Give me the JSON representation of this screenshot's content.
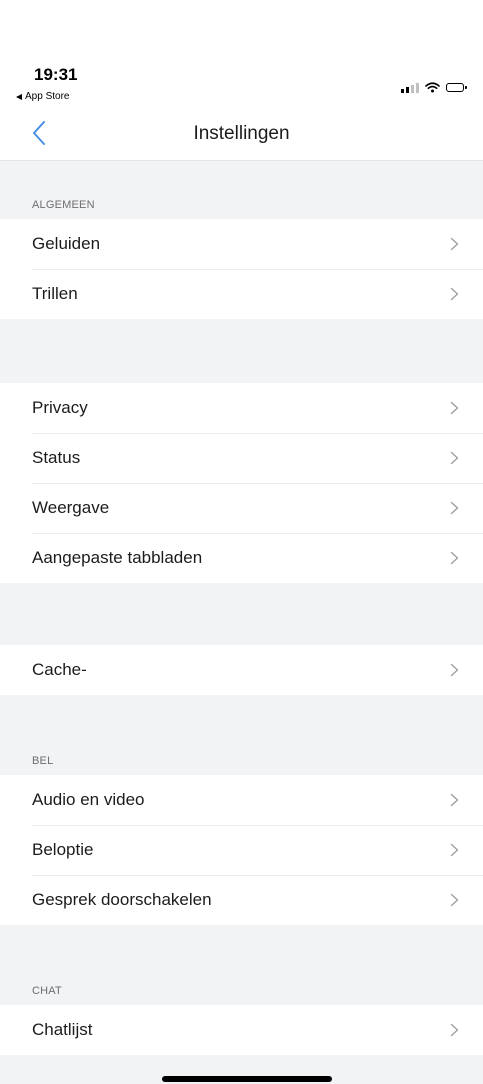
{
  "status_bar": {
    "time": "19:31",
    "back_app": "App Store",
    "icons": [
      "cellular-signal-icon",
      "wifi-icon",
      "battery-icon"
    ]
  },
  "nav": {
    "title": "Instellingen",
    "back_icon": "chevron-left-icon"
  },
  "colors": {
    "accent": "#4a90e2",
    "background": "#f2f3f5",
    "row_background": "#ffffff",
    "section_label": "#6d6d72",
    "chevron": "#9e9ea3"
  },
  "sections": [
    {
      "header": "ALGEMEEN",
      "items": [
        {
          "label": "Geluiden"
        },
        {
          "label": "Trillen"
        }
      ]
    },
    {
      "header": "",
      "items": [
        {
          "label": "Privacy"
        },
        {
          "label": "Status"
        },
        {
          "label": "Weergave"
        },
        {
          "label": "Aangepaste tabbladen"
        }
      ]
    },
    {
      "header": "",
      "items": [
        {
          "label": "Cache-"
        }
      ]
    },
    {
      "header": "BEL",
      "items": [
        {
          "label": "Audio en video"
        },
        {
          "label": "Beloptie"
        },
        {
          "label": "Gesprek doorschakelen"
        }
      ]
    },
    {
      "header": "CHAT",
      "items": [
        {
          "label": "Chatlijst"
        }
      ]
    }
  ]
}
